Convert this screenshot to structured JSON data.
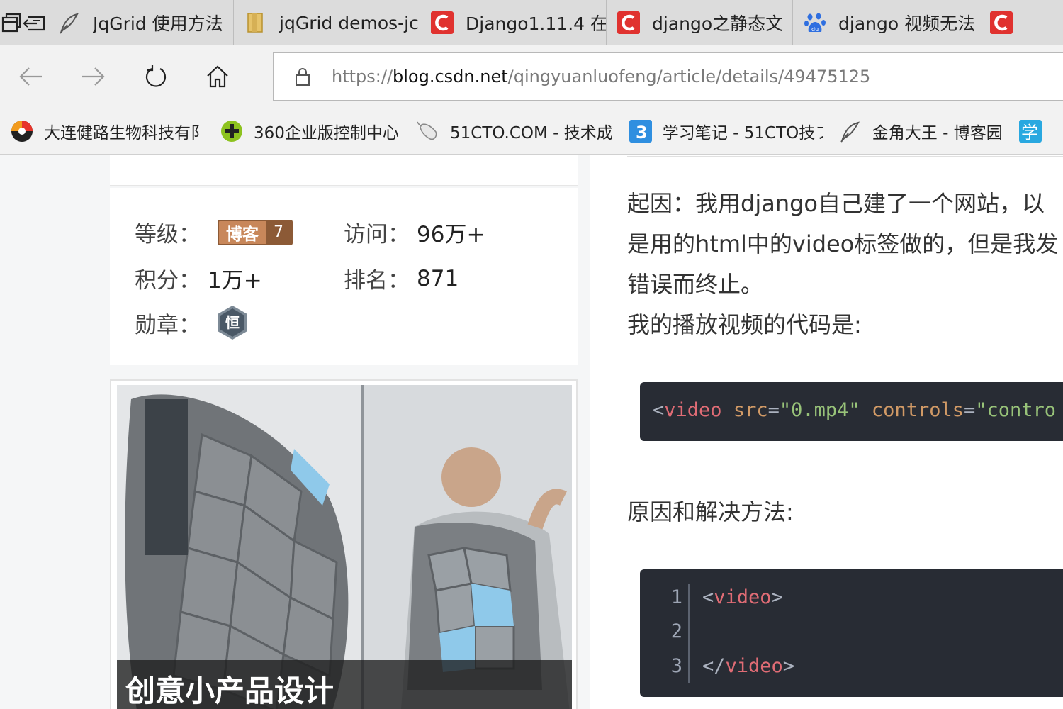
{
  "tabs": [
    {
      "title": "JqGrid 使用方法",
      "icon": "feather-icon"
    },
    {
      "title": "jqGrid demos-jc",
      "icon": "folder-icon"
    },
    {
      "title": "Django1.11.4 在",
      "icon": "csdn-icon"
    },
    {
      "title": "django之静态文",
      "icon": "csdn-icon"
    },
    {
      "title": "django 视频无法",
      "icon": "baidu-paw-icon"
    },
    {
      "title": "",
      "icon": "csdn-icon"
    }
  ],
  "nav": {
    "url_prefix": "https://",
    "url_host": "blog.csdn.net",
    "url_path": "/qingyuanluofeng/article/details/49475125"
  },
  "favorites": [
    {
      "label": "大连健路生物科技有阝",
      "icon": "fan-logo-icon"
    },
    {
      "label": "360企业版控制中心",
      "icon": "plus-circle-icon"
    },
    {
      "label": "51CTO.COM - 技术成",
      "icon": "mouse-icon"
    },
    {
      "label": "学习笔记 - 51CTO技フ",
      "icon": "number-3-icon"
    },
    {
      "label": "金角大王 - 博客园",
      "icon": "feather-icon"
    },
    {
      "label": "",
      "icon": "xue-icon"
    }
  ],
  "profile": {
    "level_label": "等级：",
    "level_badge": "博客",
    "level_number": "7",
    "visits_label": "访问：",
    "visits_value": "96万+",
    "points_label": "积分：",
    "points_value": "1万+",
    "rank_label": "排名：",
    "rank_value": "871",
    "medal_label": "勋章：",
    "medal_char": "恒"
  },
  "ad": {
    "caption": "创意小产品设计"
  },
  "article": {
    "para1_line1": "起因：我用django自己建了一个网站，以",
    "para1_line2": "是用的html中的video标签做的，但是我发",
    "para1_line3": "错误而终止。",
    "para2": "我的播放视频的代码是:",
    "code1": {
      "open": "<",
      "tag": "video",
      "attr1": "src",
      "eq": "=",
      "val1": "\"0.mp4\"",
      "attr2": "controls",
      "val2": "\"contro"
    },
    "heading2": "原因和解决方法:",
    "code2": [
      {
        "num": "1",
        "open": "<",
        "tag": "video",
        "close": ">"
      },
      {
        "num": "2",
        "open": "",
        "tag": "",
        "close": ""
      },
      {
        "num": "3",
        "open": "</",
        "tag": "video",
        "close": ">"
      }
    ]
  },
  "colors": {
    "code_bg": "#282c34",
    "tag": "#e06c75",
    "attr": "#d19a66",
    "string": "#98c379",
    "csdn_red": "#e0322f",
    "badge_brown": "#c8875a"
  }
}
